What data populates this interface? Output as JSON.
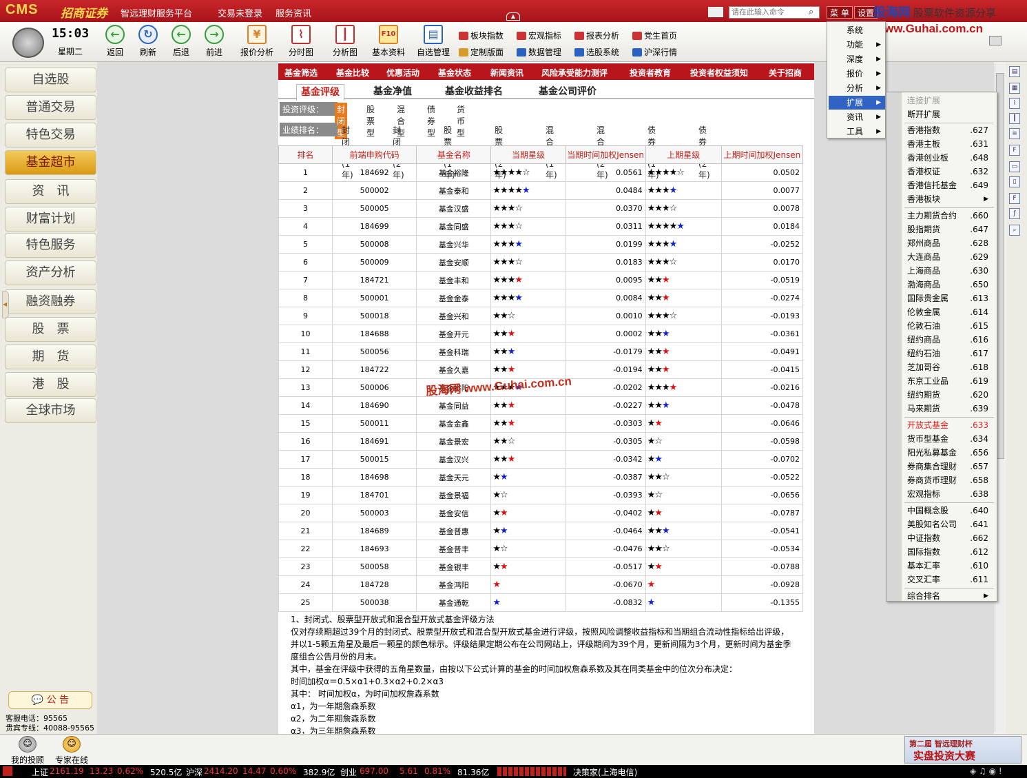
{
  "app": {
    "logo": "CMS",
    "brand": "招商证券",
    "platform": "智远理财服务平台",
    "login_status": "交易未登录",
    "news_service": "服务资讯",
    "command_placeholder": "请在此输入命令",
    "menu_label": "菜 单",
    "settings_label": "设置"
  },
  "watermark": {
    "site": "股海网",
    "tagline": "股票软件资源分享",
    "url": "Www.Guhai.com.cn",
    "center": "股海网 www.Guhai.com.cn"
  },
  "clock": {
    "time": "15:03",
    "day": "星期二"
  },
  "toolbar": {
    "back": "返回",
    "refresh": "刷新",
    "backward": "后退",
    "forward": "前进",
    "quote_analysis": "报价分析",
    "timeshare": "分时图",
    "analysis": "分析图",
    "fundamentals": "基本资料",
    "watchlist": "自选管理",
    "sector_index": "板块指数",
    "macro": "宏观指标",
    "report": "报表分析",
    "party": "党生首页",
    "custom_layout": "定制版面",
    "data_mgmt": "数据管理",
    "stock_picker": "选股系统",
    "shsz": "沪深行情",
    "f10_label": "F10"
  },
  "left_nav": [
    "自选股",
    "普通交易",
    "特色交易",
    "基金超市",
    "资　讯",
    "财富计划",
    "特色服务",
    "资产分析",
    "融资融券",
    "股　票",
    "期　货",
    "港　股",
    "全球市场"
  ],
  "left_active_index": 3,
  "notice": "公 告",
  "service": {
    "hotline": "客服电话：95565",
    "vip": "贵宾专线：40088-95565"
  },
  "bottom_buttons": {
    "my_advisor": "我的投顾",
    "expert_online": "专家在线"
  },
  "red_menu": [
    "基金筛选",
    "基金比较",
    "优惠活动",
    "基金状态",
    "新闻资讯",
    "风险承受能力测评",
    "投资者教育",
    "投资者权益须知",
    "关于招商"
  ],
  "sub_tabs": [
    "基金评级",
    "基金净值",
    "基金收益排名",
    "基金公司评价"
  ],
  "filter": {
    "rating_label": "投资评级：",
    "rating_options": [
      "封闭型",
      "股票型",
      "混合型",
      "债券型",
      "货币型"
    ],
    "rank_label": "业绩排名：",
    "rank_options": [
      "封闭型(1年)",
      "封闭型(2年)",
      "股票型(1年)",
      "股票型(2年)",
      "混合型(1年)",
      "混合型(2年)",
      "债券型(1年)",
      "债券型(2年)"
    ]
  },
  "table": {
    "headers": [
      "排名",
      "前端申购代码",
      "基金名称",
      "当期星级",
      "当期时间加权Jensen",
      "上期星级",
      "上期时间加权Jensen"
    ],
    "rows": [
      [
        "1",
        "184692",
        "基金裕隆",
        "★★★★☆",
        "0.0561",
        "★★★★☆",
        "0.0502"
      ],
      [
        "2",
        "500002",
        "基金泰和",
        "★★★★★",
        "0.0484",
        "★★★★",
        "0.0077"
      ],
      [
        "3",
        "500005",
        "基金汉盛",
        "★★★☆",
        "0.0370",
        "★★★☆",
        "0.0078"
      ],
      [
        "4",
        "184699",
        "基金同盛",
        "★★★☆",
        "0.0311",
        "★★★★★",
        "0.0184"
      ],
      [
        "5",
        "500008",
        "基金兴华",
        "★★★★",
        "0.0199",
        "★★★★",
        "-0.0252"
      ],
      [
        "6",
        "500009",
        "基金安顺",
        "★★★☆",
        "0.0183",
        "★★★☆",
        "0.0170"
      ],
      [
        "7",
        "184721",
        "基金丰和",
        "★★★★",
        "0.0095",
        "★★★",
        "-0.0519"
      ],
      [
        "8",
        "500001",
        "基金金泰",
        "★★★★",
        "0.0084",
        "★★★",
        "-0.0274"
      ],
      [
        "9",
        "500018",
        "基金兴和",
        "★★☆",
        "0.0010",
        "★★★☆",
        "-0.0193"
      ],
      [
        "10",
        "184688",
        "基金开元",
        "★★★",
        "0.0002",
        "★★★",
        "-0.0361"
      ],
      [
        "11",
        "500056",
        "基金科瑞",
        "★★★",
        "-0.0179",
        "★★★",
        "-0.0491"
      ],
      [
        "12",
        "184722",
        "基金久嘉",
        "★★★",
        "-0.0194",
        "★★★",
        "-0.0415"
      ],
      [
        "13",
        "500006",
        "基金裕阳",
        "★★★★",
        "-0.0202",
        "★★★★",
        "-0.0216"
      ],
      [
        "14",
        "184690",
        "基金同益",
        "★★★",
        "-0.0227",
        "★★★",
        "-0.0478"
      ],
      [
        "15",
        "500011",
        "基金金鑫",
        "★★★",
        "-0.0303",
        "★★",
        "-0.0646"
      ],
      [
        "16",
        "184691",
        "基金景宏",
        "★★☆",
        "-0.0305",
        "★☆",
        "-0.0598"
      ],
      [
        "17",
        "500015",
        "基金汉兴",
        "★★★",
        "-0.0342",
        "★★",
        "-0.0702"
      ],
      [
        "18",
        "184698",
        "基金天元",
        "★★",
        "-0.0387",
        "★★☆",
        "-0.0522"
      ],
      [
        "19",
        "184701",
        "基金景福",
        "★☆",
        "-0.0393",
        "★☆",
        "-0.0656"
      ],
      [
        "20",
        "500003",
        "基金安信",
        "★★",
        "-0.0402",
        "★★",
        "-0.0787"
      ],
      [
        "21",
        "184689",
        "基金普惠",
        "★★",
        "-0.0464",
        "★★★",
        "-0.0541"
      ],
      [
        "22",
        "184693",
        "基金普丰",
        "★☆",
        "-0.0476",
        "★★☆",
        "-0.0534"
      ],
      [
        "23",
        "500058",
        "基金银丰",
        "★★",
        "-0.0517",
        "★★",
        "-0.0788"
      ],
      [
        "24",
        "184728",
        "基金鸿阳",
        "★",
        "-0.0670",
        "★",
        "-0.0928"
      ],
      [
        "25",
        "500038",
        "基金通乾",
        "★",
        "-0.0832",
        "★",
        "-0.1355"
      ]
    ],
    "star_colors": {
      "full": "#000000",
      "red": "#dd1111",
      "blue": "#1122cc"
    }
  },
  "notes": [
    "1、封闭式、股票型开放式和混合型开放式基金评级方法",
    "仅对存续期超过39个月的封闭式、股票型开放式和混合型开放式基金进行评级，按照风险调整收益指标和当期组合流动性指标给出评级，",
    "并以1-5颗五角星及最后一颗星的颜色标示。评级结果定期公布在公司网站上，评级期间为39个月，更新间隔为3个月，更新时间为基金季",
    "度组合公告月份的月末。",
    "其中，基金在评级中获得的五角星数量，由按以下公式计算的基金的时间加权詹森系数及其在同类基金中的位次分布决定：",
    "时间加权α＝0.5×α1+0.3×α2+0.2×α3",
    "其中：  时间加权α，为时间加权詹森系数",
    "α1，为一年期詹森系数",
    "α2，为二年期詹森系数",
    "α3，为三年期詹森系数"
  ],
  "menu1": [
    "系统",
    "功能",
    "深度",
    "报价",
    "分析",
    "扩展",
    "资讯",
    "工具"
  ],
  "menu1_active": "扩展",
  "menu2": {
    "connect": "连接扩展",
    "disconnect": "断开扩展",
    "items": [
      {
        "name": "香港指数",
        "code": ".627"
      },
      {
        "name": "香港主板",
        "code": ".631"
      },
      {
        "name": "香港创业板",
        "code": ".648"
      },
      {
        "name": "香港权证",
        "code": ".632"
      },
      {
        "name": "香港信托基金",
        "code": ".649"
      },
      {
        "name": "香港板块",
        "code": ""
      },
      {
        "name": "主力期货合约",
        "code": ".660"
      },
      {
        "name": "股指期货",
        "code": ".647"
      },
      {
        "name": "郑州商品",
        "code": ".628"
      },
      {
        "name": "大连商品",
        "code": ".629"
      },
      {
        "name": "上海商品",
        "code": ".630"
      },
      {
        "name": "渤海商品",
        "code": ".650"
      },
      {
        "name": "国际贵金属",
        "code": ".613"
      },
      {
        "name": "伦敦金属",
        "code": ".614"
      },
      {
        "name": "伦敦石油",
        "code": ".615"
      },
      {
        "name": "纽约商品",
        "code": ".616"
      },
      {
        "name": "纽约石油",
        "code": ".617"
      },
      {
        "name": "芝加哥谷",
        "code": ".618"
      },
      {
        "name": "东京工业品",
        "code": ".619"
      },
      {
        "name": "纽约期货",
        "code": ".620"
      },
      {
        "name": "马来期货",
        "code": ".639"
      },
      {
        "name": "开放式基金",
        "code": ".633"
      },
      {
        "name": "货币型基金",
        "code": ".634"
      },
      {
        "name": "阳光私募基金",
        "code": ".656"
      },
      {
        "name": "券商集合理财",
        "code": ".657"
      },
      {
        "name": "券商货币理财",
        "code": ".658"
      },
      {
        "name": "宏观指标",
        "code": ".638"
      },
      {
        "name": "中国概念股",
        "code": ".640"
      },
      {
        "name": "美股知名公司",
        "code": ".641"
      },
      {
        "name": "中证指数",
        "code": ".662"
      },
      {
        "name": "国际指数",
        "code": ".612"
      },
      {
        "name": "基本汇率",
        "code": ".610"
      },
      {
        "name": "交叉汇率",
        "code": ".611"
      },
      {
        "name": "综合排名",
        "code": ""
      }
    ]
  },
  "ad": {
    "line1": "第二届 智远理财杯",
    "line2": "实盘投资大赛"
  },
  "ticker": {
    "sh_label": "上证",
    "sh_value": "2161.19",
    "sh_change": "13.23",
    "sh_pct": "0.62%",
    "sh_amount": "520.5亿",
    "sz_label": "沪深",
    "sz_value": "2414.20",
    "sz_change": "14.47",
    "sz_pct": "0.60%",
    "sz_amount": "382.9亿",
    "cy_label": "创业",
    "cy_value": "697.00",
    "cy_change": "5.61",
    "cy_pct": "0.81%",
    "cy_amount": "81.36亿",
    "server": "决策家(上海电信)"
  }
}
